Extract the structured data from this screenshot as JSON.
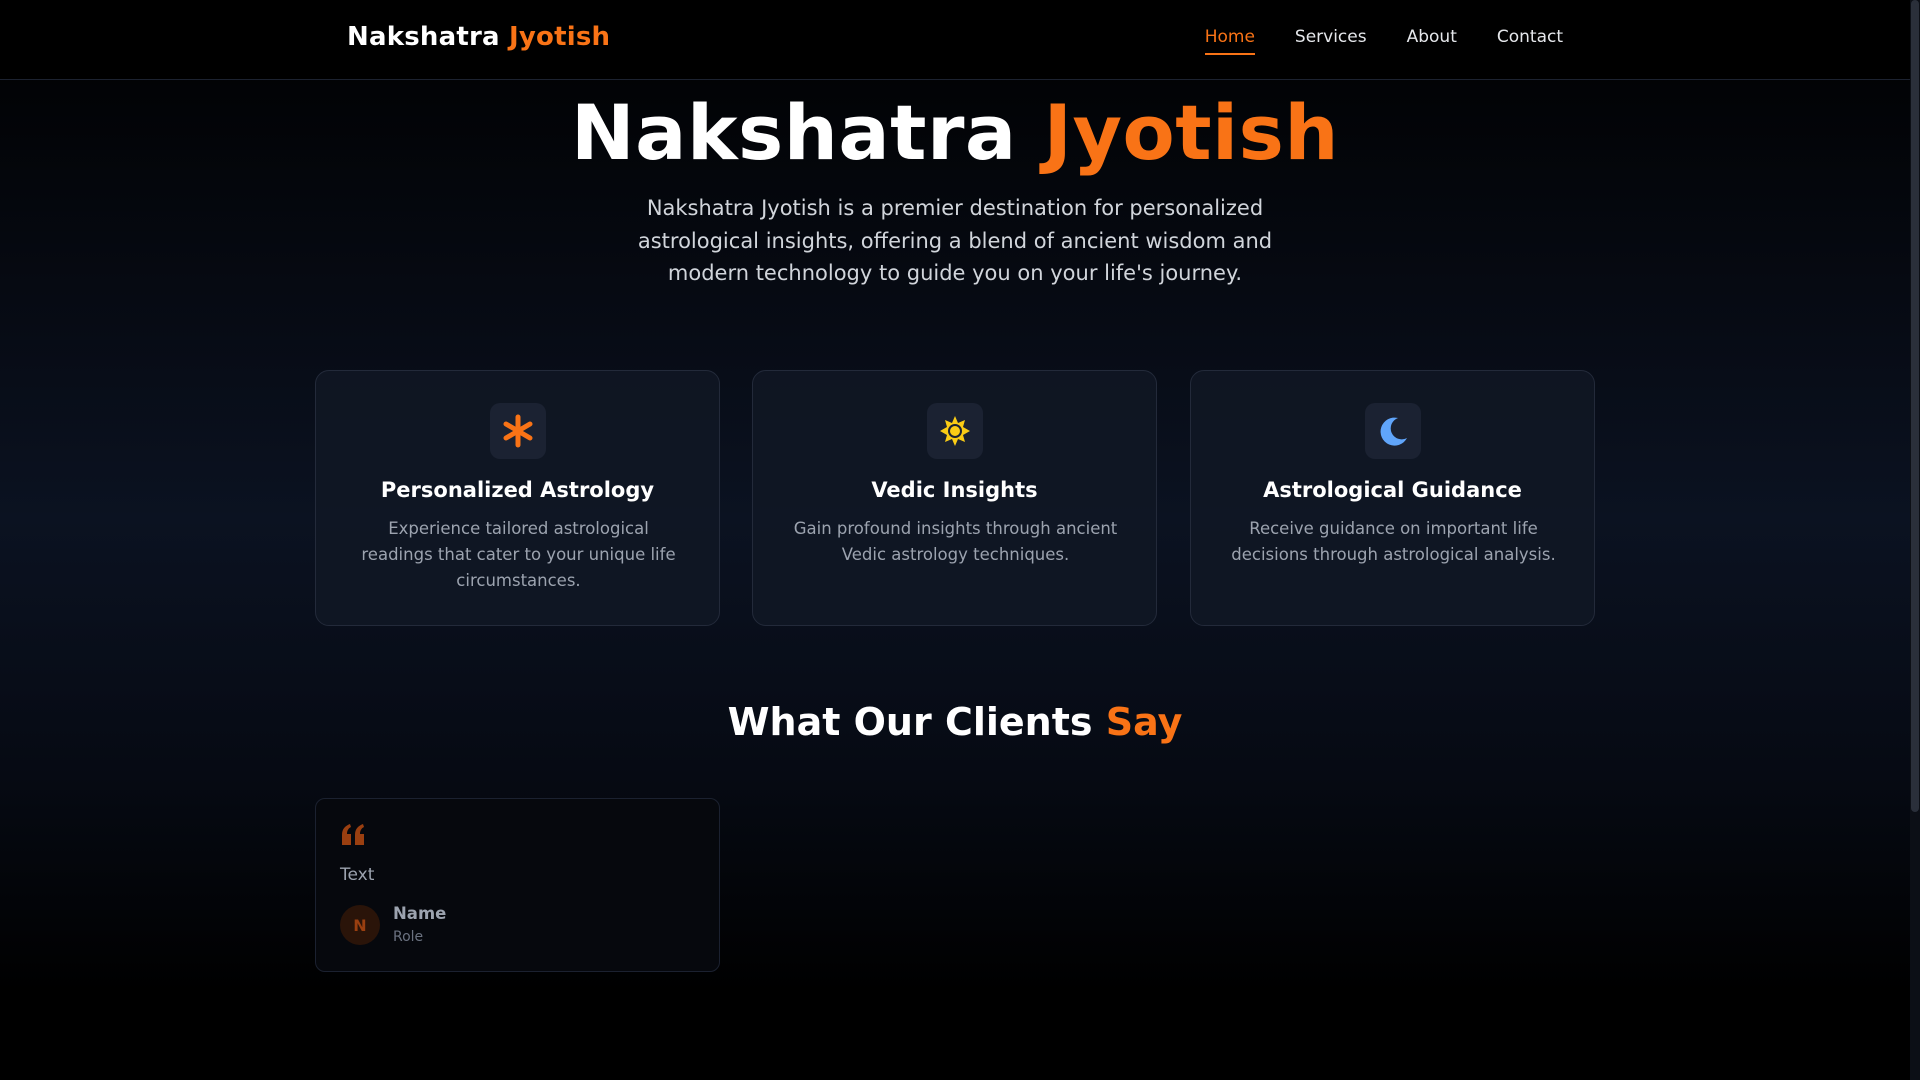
{
  "nav": {
    "brand_main": "Nakshatra",
    "brand_accent": "Jyotish",
    "links": [
      {
        "label": "Home",
        "active": true
      },
      {
        "label": "Services",
        "active": false
      },
      {
        "label": "About",
        "active": false
      },
      {
        "label": "Contact",
        "active": false
      }
    ]
  },
  "hero": {
    "title_main": "Nakshatra",
    "title_accent": "Jyotish",
    "description": "Nakshatra Jyotish is a premier destination for personalized astrological insights, offering a blend of ancient wisdom and modern technology to guide you on your life's journey."
  },
  "features": [
    {
      "icon": "asterisk-icon",
      "title": "Personalized Astrology",
      "text": "Experience tailored astrological readings that cater to your unique life circumstances."
    },
    {
      "icon": "sun-icon",
      "title": "Vedic Insights",
      "text": "Gain profound insights through ancient Vedic astrology techniques."
    },
    {
      "icon": "moon-icon",
      "title": "Astrological Guidance",
      "text": "Receive guidance on important life decisions through astrological analysis."
    }
  ],
  "testimonials": {
    "title_main": "What Our Clients",
    "title_accent": "Say",
    "items": [
      {
        "text": "Text",
        "avatar_initial": "N",
        "name": "Name",
        "role": "Role"
      }
    ]
  },
  "colors": {
    "accent": "#f97316",
    "background": "#000000",
    "card": "#111725",
    "sun": "#facc15",
    "moon": "#60a5fa"
  }
}
